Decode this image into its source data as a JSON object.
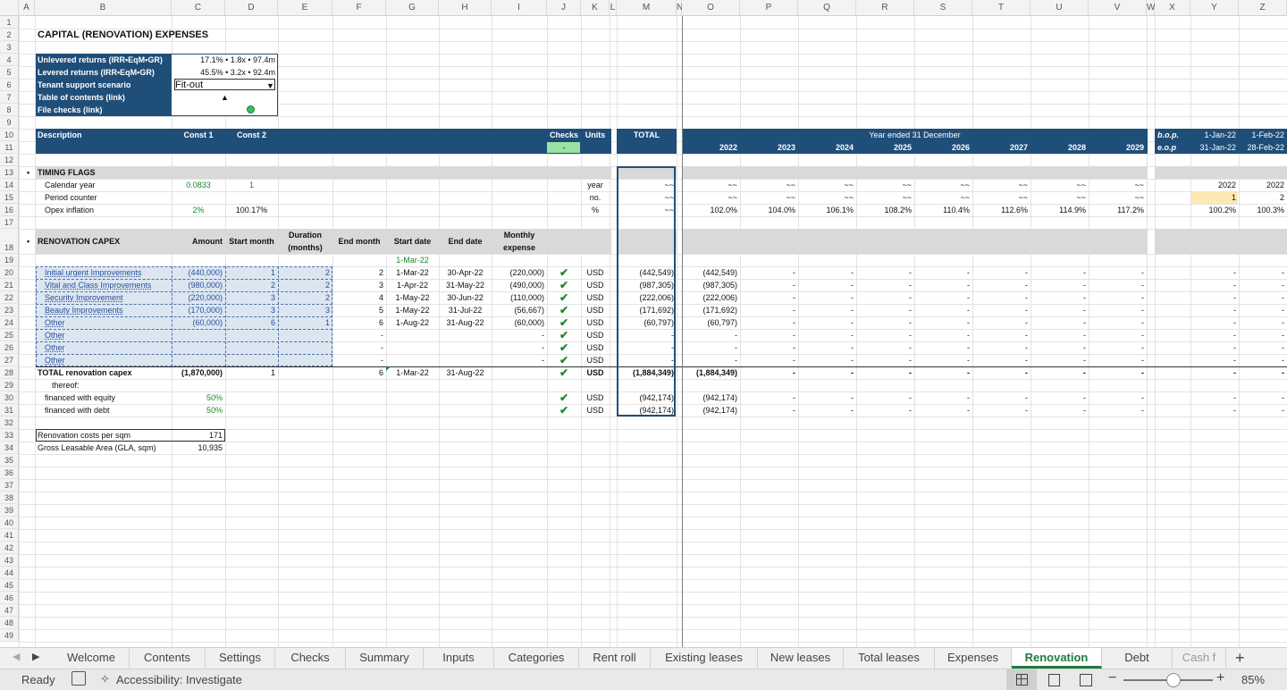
{
  "columns": [
    "A",
    "B",
    "C",
    "D",
    "E",
    "F",
    "G",
    "H",
    "I",
    "J",
    "K",
    "L",
    "M",
    "N",
    "O",
    "P",
    "Q",
    "R",
    "S",
    "T",
    "U",
    "V",
    "W",
    "X",
    "Y",
    "Z"
  ],
  "rows": [
    "1",
    "2",
    "3",
    "4",
    "5",
    "6",
    "7",
    "8",
    "9",
    "10",
    "11",
    "12",
    "13",
    "14",
    "15",
    "16",
    "17",
    "18",
    "19",
    "20",
    "21",
    "22",
    "23",
    "24",
    "25",
    "26",
    "27",
    "28",
    "29",
    "30",
    "31",
    "32",
    "33",
    "34",
    "35",
    "36",
    "37",
    "38",
    "39",
    "40",
    "41",
    "42",
    "43",
    "44",
    "45",
    "46",
    "47",
    "48",
    "49"
  ],
  "title": "CAPITAL (RENOVATION) EXPENSES",
  "summary": {
    "unlevered_label": "Unlevered returns (IRR•EqM•GR)",
    "unlevered_value": "17.1% • 1.8x • 97.4m",
    "levered_label": "Levered returns (IRR•EqM•GR)",
    "levered_value": "45.5% • 3.2x • 92.4m",
    "scenario_label": "Tenant support scenario",
    "scenario_value": "Fit-out",
    "toc_label": "Table of contents (link)",
    "toc_symbol": "▲",
    "checks_label": "File checks (link)"
  },
  "header": {
    "description": "Description",
    "const1": "Const 1",
    "const2": "Const 2",
    "checks": "Checks",
    "units": "Units",
    "checks_value": "-",
    "total": "TOTAL",
    "year_ended": "Year ended 31 December",
    "years": [
      "2022",
      "2023",
      "2024",
      "2025",
      "2026",
      "2027",
      "2028",
      "2029"
    ],
    "bop": "b.o.p.",
    "eop": "e.o.p",
    "bop_dates": [
      "1-Jan-22",
      "1-Feb-22"
    ],
    "eop_dates": [
      "31-Jan-22",
      "28-Feb-22"
    ]
  },
  "timing": {
    "section": "TIMING FLAGS",
    "rows": [
      {
        "label": "Calendar year",
        "c": "0.0833",
        "d": "1",
        "unit": "year",
        "total": "~~",
        "years": [
          "~~",
          "~~",
          "~~",
          "~~",
          "~~",
          "~~",
          "~~",
          "~~"
        ],
        "y": "2022",
        "z": "2022"
      },
      {
        "label": "Period counter",
        "c": "",
        "d": "",
        "unit": "no.",
        "total": "~~",
        "years": [
          "~~",
          "~~",
          "~~",
          "~~",
          "~~",
          "~~",
          "~~",
          "~~"
        ],
        "y": "1",
        "z": "2"
      },
      {
        "label": "Opex inflation",
        "c": "2%",
        "d": "100.17%",
        "unit": "%",
        "total": "~~",
        "years": [
          "102.0%",
          "104.0%",
          "106.1%",
          "108.2%",
          "110.4%",
          "112.6%",
          "114.9%",
          "117.2%"
        ],
        "y": "100.2%",
        "z": "100.3%"
      }
    ]
  },
  "capex": {
    "section": "RENOVATION CAPEX",
    "h_amount": "Amount",
    "h_start_month": "Start month",
    "h_duration_1": "Duration",
    "h_duration_2": "(months)",
    "h_end_month": "End month",
    "h_start_date": "Start date",
    "h_end_date": "End date",
    "h_monthly_1": "Monthly",
    "h_monthly_2": "expense",
    "first_date": "1-Mar-22",
    "items": [
      {
        "label": "Initial urgent Improvements",
        "amount": "(440,000)",
        "start": "1",
        "dur": "2",
        "end": "2",
        "sdate": "1-Mar-22",
        "edate": "30-Apr-22",
        "monthly": "(220,000)",
        "unit": "USD",
        "total": "(442,549)",
        "y2022": "(442,549)"
      },
      {
        "label": "Vital and Class Improvements",
        "amount": "(980,000)",
        "start": "2",
        "dur": "2",
        "end": "3",
        "sdate": "1-Apr-22",
        "edate": "31-May-22",
        "monthly": "(490,000)",
        "unit": "USD",
        "total": "(987,305)",
        "y2022": "(987,305)"
      },
      {
        "label": "Security Improvement",
        "amount": "(220,000)",
        "start": "3",
        "dur": "2",
        "end": "4",
        "sdate": "1-May-22",
        "edate": "30-Jun-22",
        "monthly": "(110,000)",
        "unit": "USD",
        "total": "(222,006)",
        "y2022": "(222,006)"
      },
      {
        "label": "Beauty Improvements",
        "amount": "(170,000)",
        "start": "3",
        "dur": "3",
        "end": "5",
        "sdate": "1-May-22",
        "edate": "31-Jul-22",
        "monthly": "(56,667)",
        "unit": "USD",
        "total": "(171,692)",
        "y2022": "(171,692)"
      },
      {
        "label": "Other",
        "amount": "(60,000)",
        "start": "6",
        "dur": "1",
        "end": "6",
        "sdate": "1-Aug-22",
        "edate": "31-Aug-22",
        "monthly": "(60,000)",
        "unit": "USD",
        "total": "(60,797)",
        "y2022": "(60,797)"
      },
      {
        "label": "Other",
        "amount": "",
        "start": "",
        "dur": "",
        "end": "-",
        "sdate": "",
        "edate": "",
        "monthly": "-",
        "unit": "USD",
        "total": "-",
        "y2022": "-"
      },
      {
        "label": "Other",
        "amount": "",
        "start": "",
        "dur": "",
        "end": "-",
        "sdate": "",
        "edate": "",
        "monthly": "-",
        "unit": "USD",
        "total": "-",
        "y2022": "-"
      },
      {
        "label": "Other",
        "amount": "",
        "start": "",
        "dur": "",
        "end": "-",
        "sdate": "",
        "edate": "",
        "monthly": "-",
        "unit": "USD",
        "total": "-",
        "y2022": "-"
      }
    ],
    "total_label": "TOTAL renovation capex",
    "total_amount": "(1,870,000)",
    "total_start": "1",
    "total_end": "6",
    "total_sdate": "1-Mar-22",
    "total_edate": "31-Aug-22",
    "total_unit": "USD",
    "total_total": "(1,884,349)",
    "total_2022": "(1,884,349)",
    "thereof": "thereof:",
    "equity_label": "financed with equity",
    "equity_pct": "50%",
    "equity_total": "(942,174)",
    "equity_2022": "(942,174)",
    "debt_label": "financed with debt",
    "debt_pct": "50%",
    "debt_total": "(942,174)",
    "debt_2022": "(942,174)",
    "unit_usd": "USD",
    "dash": "-",
    "check_symbol": "✔",
    "per_sqm_label": "Renovation costs per sqm",
    "per_sqm_value": "171",
    "gla_label": "Gross Leasable Area (GLA, sqm)",
    "gla_value": "10,935"
  },
  "tabs": [
    "Welcome",
    "Contents",
    "Settings",
    "Checks",
    "Summary",
    "Inputs",
    "Categories",
    "Rent roll",
    "Existing leases",
    "New leases",
    "Total leases",
    "Expenses",
    "Renovation",
    "Debt",
    "Cash f"
  ],
  "active_tab": "Renovation",
  "status": {
    "ready": "Ready",
    "accessibility": "Accessibility: Investigate",
    "zoom": "85%",
    "zoom_level": 0.55
  },
  "colors": {
    "navy": "#1f4e79",
    "section_gray": "#d9d9d9",
    "input_fill": "#dce6f1",
    "check_green": "#1f8a2c",
    "accent_green": "#1e7a3e",
    "highlight": "#fde9b3"
  }
}
